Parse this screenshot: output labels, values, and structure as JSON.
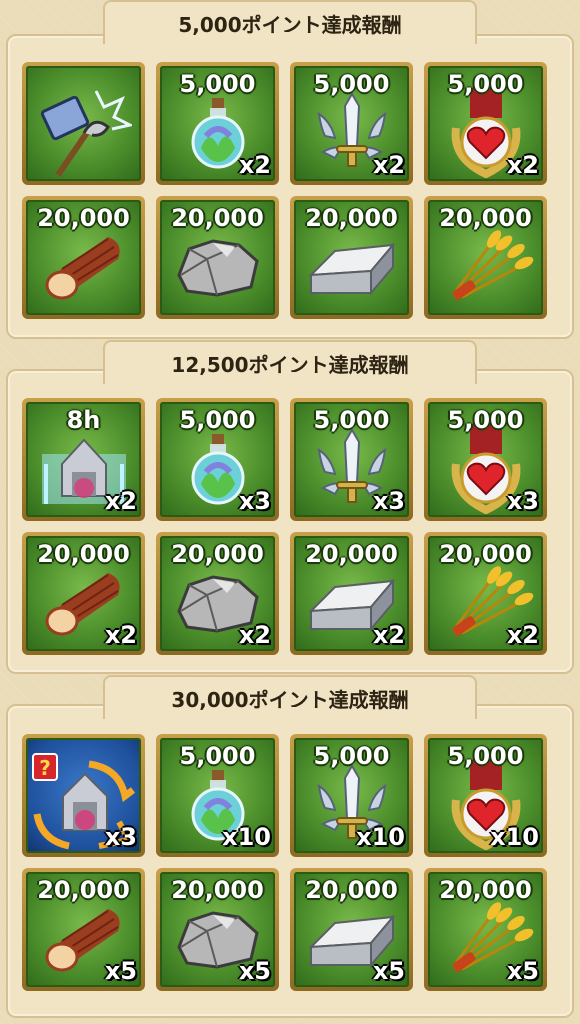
{
  "sections": [
    {
      "title": "5,000ポイント達成報酬",
      "rewards": [
        {
          "icon": "speed-skill-icon",
          "amount": "",
          "qty": ""
        },
        {
          "icon": "potion-icon",
          "amount": "5,000",
          "qty": "x2"
        },
        {
          "icon": "sword-emblem-icon",
          "amount": "5,000",
          "qty": "x2"
        },
        {
          "icon": "heart-medal-icon",
          "amount": "5,000",
          "qty": "x2"
        },
        {
          "icon": "wood-log-icon",
          "amount": "20,000",
          "qty": ""
        },
        {
          "icon": "stone-ore-icon",
          "amount": "20,000",
          "qty": ""
        },
        {
          "icon": "iron-ingot-icon",
          "amount": "20,000",
          "qty": ""
        },
        {
          "icon": "wheat-bundle-icon",
          "amount": "20,000",
          "qty": ""
        }
      ]
    },
    {
      "title": "12,500ポイント達成報酬",
      "rewards": [
        {
          "icon": "shield-dome-icon",
          "amount": "8h",
          "qty": "x2"
        },
        {
          "icon": "potion-icon",
          "amount": "5,000",
          "qty": "x3"
        },
        {
          "icon": "sword-emblem-icon",
          "amount": "5,000",
          "qty": "x3"
        },
        {
          "icon": "heart-medal-icon",
          "amount": "5,000",
          "qty": "x3"
        },
        {
          "icon": "wood-log-icon",
          "amount": "20,000",
          "qty": "x2"
        },
        {
          "icon": "stone-ore-icon",
          "amount": "20,000",
          "qty": "x2"
        },
        {
          "icon": "iron-ingot-icon",
          "amount": "20,000",
          "qty": "x2"
        },
        {
          "icon": "wheat-bundle-icon",
          "amount": "20,000",
          "qty": "x2"
        }
      ]
    },
    {
      "title": "30,000ポイント達成報酬",
      "rewards": [
        {
          "icon": "random-teleport-icon",
          "amount": "",
          "qty": "x3"
        },
        {
          "icon": "potion-icon",
          "amount": "5,000",
          "qty": "x10"
        },
        {
          "icon": "sword-emblem-icon",
          "amount": "5,000",
          "qty": "x10"
        },
        {
          "icon": "heart-medal-icon",
          "amount": "5,000",
          "qty": "x10"
        },
        {
          "icon": "wood-log-icon",
          "amount": "20,000",
          "qty": "x5"
        },
        {
          "icon": "stone-ore-icon",
          "amount": "20,000",
          "qty": "x5"
        },
        {
          "icon": "iron-ingot-icon",
          "amount": "20,000",
          "qty": "x5"
        },
        {
          "icon": "wheat-bundle-icon",
          "amount": "20,000",
          "qty": "x5"
        }
      ]
    }
  ]
}
